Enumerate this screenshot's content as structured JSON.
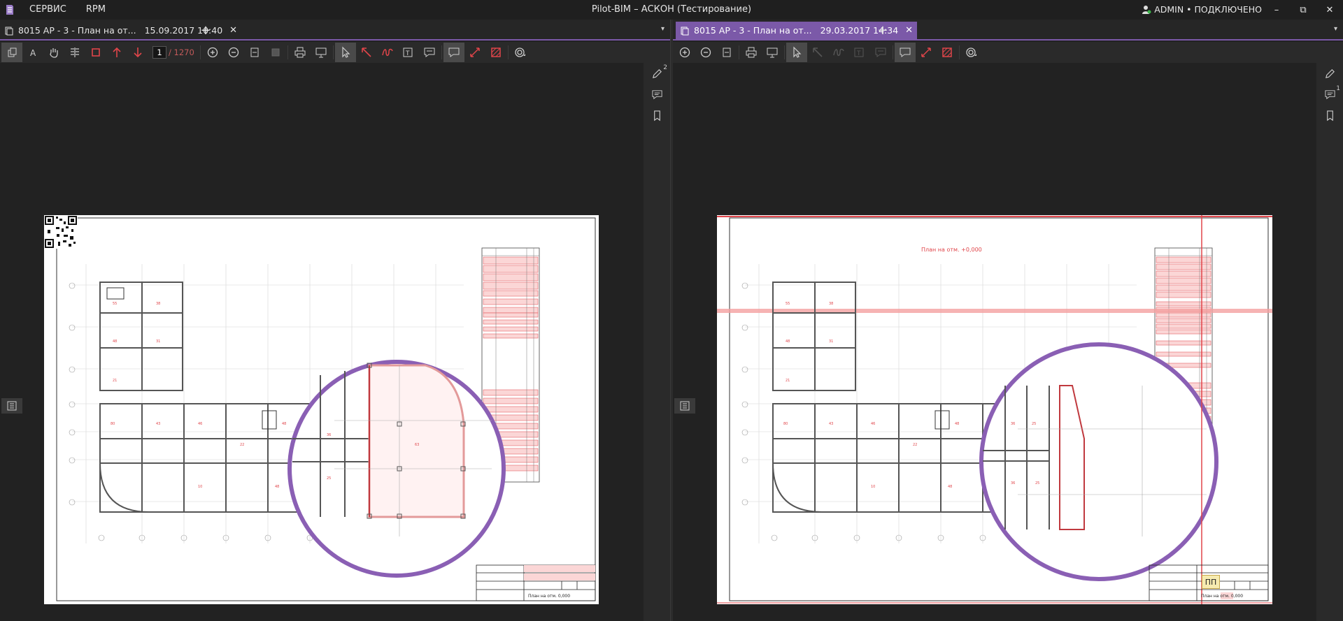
{
  "app": {
    "title": "Pilot-BIM – АСКОН (Тестирование)",
    "menu": [
      "СЕРВИС",
      "RPM"
    ],
    "user": "ADMIN • ПОДКЛЮЧЕНО",
    "accent_color": "#7b59a8",
    "markup_color": "#e0454a"
  },
  "window_controls": {
    "minimize": "–",
    "restore": "⧉",
    "close": "✕"
  },
  "left_pane": {
    "tab": {
      "title": "8015 АР - 3 - План на от...",
      "date": "15.09.2017 10:40",
      "close": "✕"
    },
    "add_tab": "+",
    "tabs_dropdown": "▾",
    "page_current": "1",
    "page_total": "/ 1270",
    "comments_count": "2",
    "stamp_text": "План на отм. 0,000"
  },
  "right_pane": {
    "tab": {
      "title": "8015 АР - 3 - План на от...",
      "date": "29.03.2017 14:34",
      "close": "✕"
    },
    "add_tab": "+",
    "tabs_dropdown": "▾",
    "comments_count": "1",
    "sheet_heading": "План на отм. +0,000",
    "stamp_text": "План на отм. 0,000",
    "badge": "ПП"
  },
  "icons": {
    "left_toolbar": [
      "pages-icon",
      "text-select-icon",
      "hand-pan-icon",
      "compare-icon",
      "crop-icon",
      "arrow-up-icon",
      "arrow-down-icon",
      "zoom-in-icon",
      "zoom-out-icon",
      "fit-page-icon",
      "fit-width-icon",
      "print-icon",
      "present-icon",
      "pointer-icon",
      "arrow-markup-icon",
      "freehand-markup-icon",
      "text-markup-icon",
      "comment-markup-icon",
      "speech-bubble-icon",
      "measure-icon",
      "hatch-icon",
      "layers-icon"
    ],
    "right_toolbar": [
      "zoom-in-icon",
      "zoom-out-icon",
      "fit-page-icon",
      "print-icon",
      "present-icon",
      "pointer-icon",
      "arrow-markup-icon",
      "freehand-markup-icon",
      "text-markup-icon",
      "comment-markup-icon",
      "speech-bubble-icon",
      "measure-icon",
      "hatch-icon",
      "layers-icon"
    ],
    "side": [
      "pencil-icon",
      "comments-icon",
      "bookmark-icon"
    ]
  }
}
